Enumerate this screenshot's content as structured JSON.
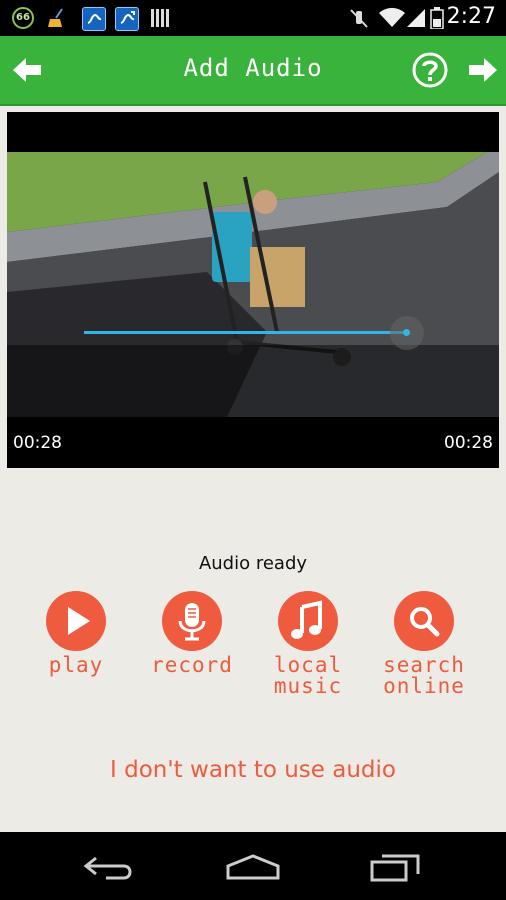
{
  "status_bar": {
    "notification_icons": [
      "battery-66-icon",
      "broom-icon",
      "app-icon",
      "app-icon",
      "barcode-icon"
    ],
    "badge_text": "66",
    "system_icons": [
      "mute-icon",
      "wifi-icon",
      "signal-icon",
      "battery-icon"
    ],
    "time": "2:27"
  },
  "action_bar": {
    "title": "Add Audio",
    "back_icon": "arrow-left-icon",
    "help_icon": "help-icon",
    "next_icon": "arrow-right-icon",
    "color": "#3ab33c"
  },
  "video": {
    "current_time": "00:28",
    "duration": "00:28",
    "progress": 1.0,
    "accent": "#33b5e5"
  },
  "audio": {
    "status": "Audio ready",
    "options": [
      {
        "label": "play",
        "icon": "play-icon"
      },
      {
        "label": "record",
        "icon": "microphone-icon"
      },
      {
        "label_line1": "local",
        "label_line2": "music",
        "icon": "music-note-icon"
      },
      {
        "label_line1": "search",
        "label_line2": "online",
        "icon": "search-icon"
      }
    ],
    "skip_link": "I don't want to use audio",
    "accent": "#ef5b3f"
  },
  "nav_bar": {
    "buttons": [
      "back-icon",
      "home-icon",
      "recent-apps-icon"
    ]
  }
}
